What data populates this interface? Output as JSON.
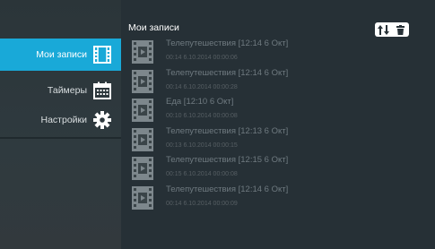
{
  "sidebar": {
    "items": [
      {
        "label": "Мои записи",
        "icon": "film-icon",
        "active": true
      },
      {
        "label": "Таймеры",
        "icon": "calendar-icon",
        "active": false
      },
      {
        "label": "Настройки",
        "icon": "gear-icon",
        "active": false
      }
    ]
  },
  "main": {
    "title": "Мои записи",
    "toolbar": {
      "sort_icon": "sort-icon",
      "delete_icon": "trash-icon"
    },
    "recordings": [
      {
        "title": "Телепутешествия  [12:14 6 Окт]",
        "meta": "00:14  6.10.2014  00:00:06"
      },
      {
        "title": "Телепутешествия  [12:14 6 Окт]",
        "meta": "00:14  6.10.2014  00:00:28"
      },
      {
        "title": "Еда  [12:10 6 Окт]",
        "meta": "00:10  6.10.2014  00:00:08"
      },
      {
        "title": "Телепутешествия  [12:13 6 Окт]",
        "meta": "00:13  6.10.2014  00:00:15"
      },
      {
        "title": "Телепутешествия  [12:15 6 Окт]",
        "meta": "00:15  6.10.2014  00:00:08"
      },
      {
        "title": "Телепутешествия  [12:14 6 Окт]",
        "meta": "00:14  6.10.2014  00:00:09"
      }
    ]
  },
  "colors": {
    "accent": "#19a9d8",
    "background": "#222a2e"
  }
}
